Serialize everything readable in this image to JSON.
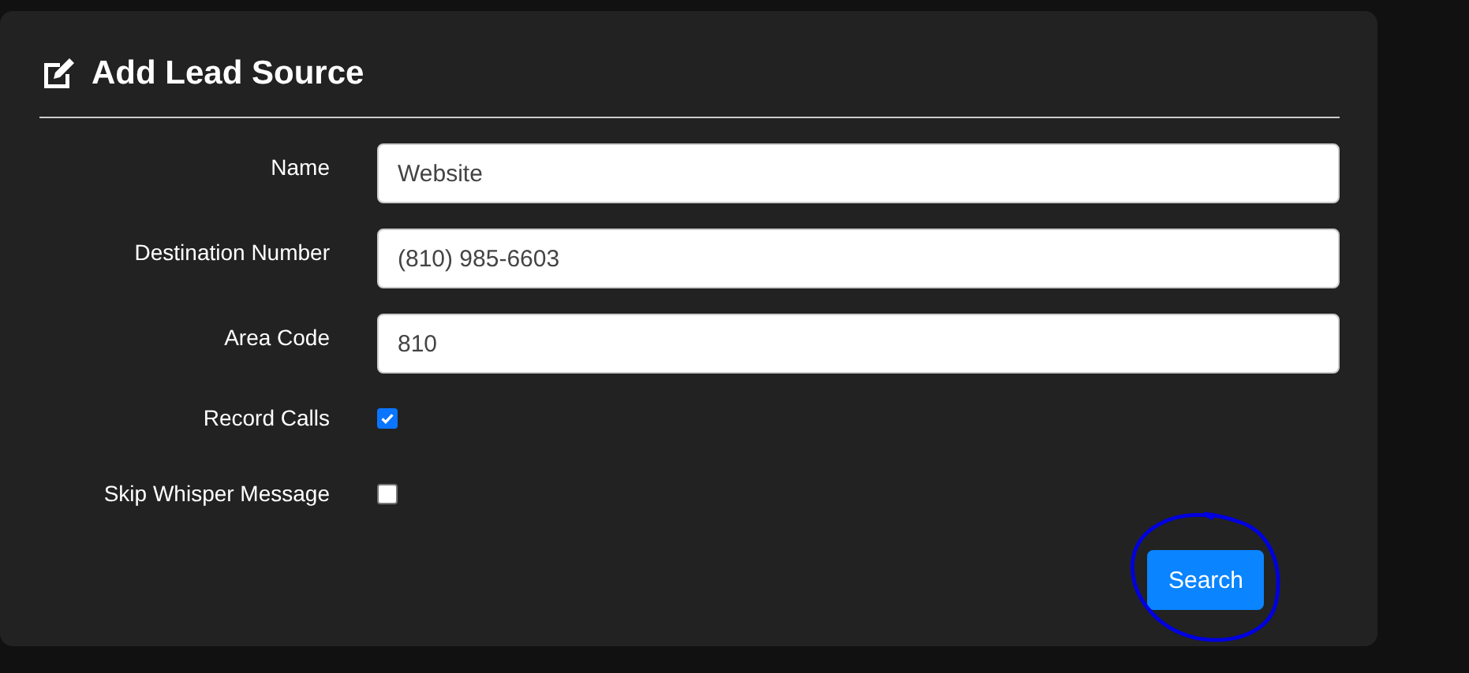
{
  "form": {
    "title": "Add Lead Source",
    "fields": [
      {
        "kind": "text",
        "label": "Name",
        "value": "Website"
      },
      {
        "kind": "text",
        "label": "Destination Number",
        "value": "(810) 985-6603"
      },
      {
        "kind": "text",
        "label": "Area Code",
        "value": "810"
      },
      {
        "kind": "checkbox",
        "label": "Record Calls",
        "checked": true
      },
      {
        "kind": "checkbox",
        "label": "Skip Whisper Message",
        "checked": false
      }
    ],
    "button": "Search"
  }
}
